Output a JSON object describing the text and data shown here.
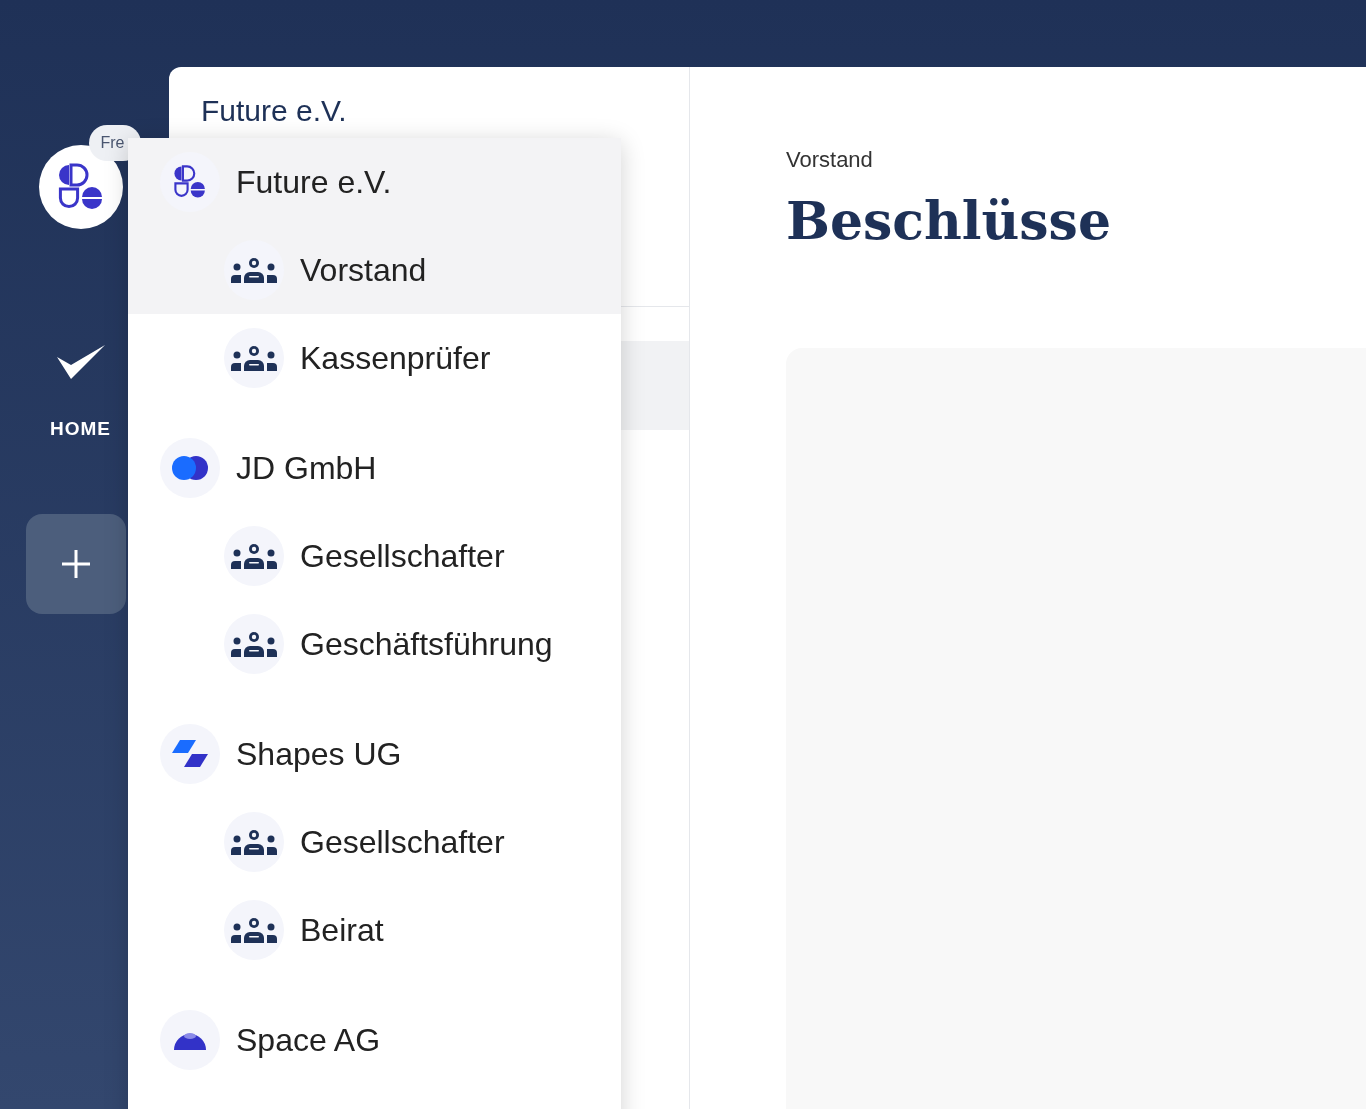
{
  "sidebar": {
    "org_badge": "Fre",
    "home_label": "HOME"
  },
  "left_panel": {
    "title": "Future e.V."
  },
  "content": {
    "breadcrumb": "Vorstand",
    "title": "Beschlüsse"
  },
  "org_menu": [
    {
      "name": "Future e.V.",
      "kind": "future",
      "selected": true,
      "children": [
        {
          "name": "Vorstand",
          "selected": true
        },
        {
          "name": "Kassenprüfer",
          "selected": false
        }
      ]
    },
    {
      "name": "JD GmbH",
      "kind": "circles",
      "selected": false,
      "children": [
        {
          "name": "Gesellschafter",
          "selected": false
        },
        {
          "name": "Geschäftsführung",
          "selected": false
        }
      ]
    },
    {
      "name": "Shapes UG",
      "kind": "shapes",
      "selected": false,
      "children": [
        {
          "name": "Gesellschafter",
          "selected": false
        },
        {
          "name": "Beirat",
          "selected": false
        }
      ]
    },
    {
      "name": "Space AG",
      "kind": "dome",
      "selected": false
    }
  ]
}
